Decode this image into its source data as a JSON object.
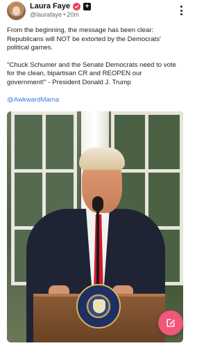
{
  "post": {
    "author": {
      "display_name": "Laura Faye",
      "handle": "@laurafaye",
      "timestamp": "20m",
      "separator": "•",
      "avatar_icon": "user-avatar"
    },
    "body": {
      "paragraph_1": "From the beginning, the message has been clear: Republicans will NOT be extorted by the Democrats' political games.",
      "paragraph_2": "\"Chuck Schumer and the Senate Democrats need to vote for the clean, bipartisan CR and REOPEN our government!\" - President Donald J. Trump",
      "mention": "@AwkwardMama"
    },
    "media": {
      "type": "video-thumbnail"
    },
    "icons": {
      "verified": "verified-badge-icon",
      "plus": "plus-badge-icon",
      "more": "more-vertical-icon",
      "compose": "compose-icon"
    }
  },
  "colors": {
    "accent": "#f0577a",
    "link": "#3d7be0",
    "verified": "#e8435f"
  }
}
